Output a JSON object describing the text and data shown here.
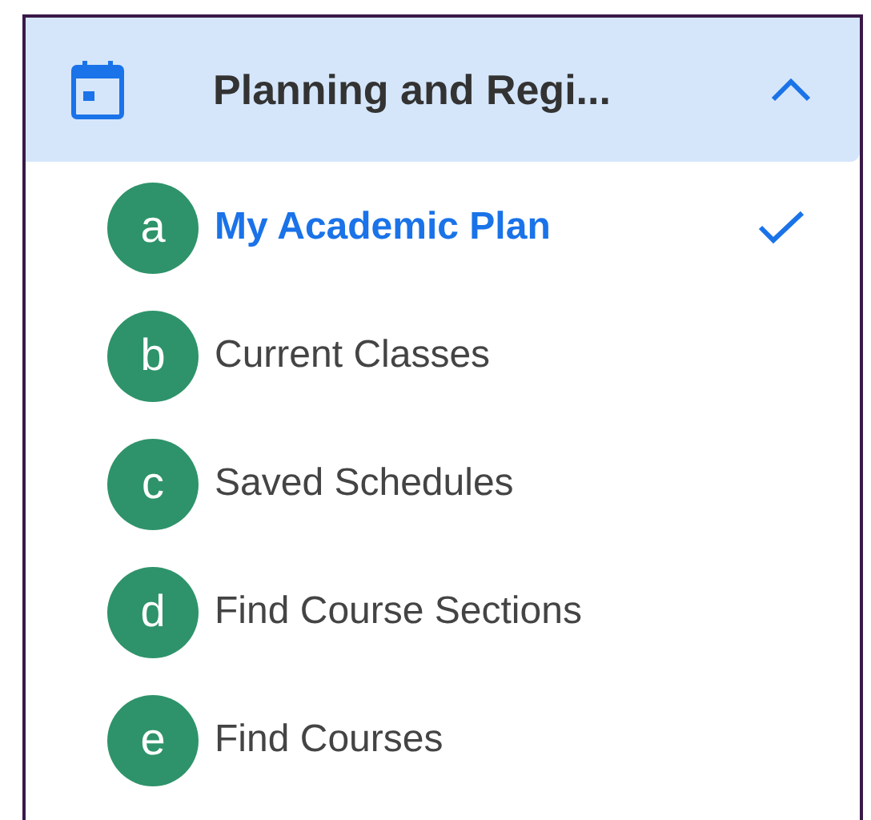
{
  "section": {
    "title": "Planning and Regi...",
    "expanded": true
  },
  "items": [
    {
      "badge": "a",
      "label": "My Academic Plan",
      "selected": true
    },
    {
      "badge": "b",
      "label": "Current Classes",
      "selected": false
    },
    {
      "badge": "c",
      "label": "Saved Schedules",
      "selected": false
    },
    {
      "badge": "d",
      "label": "Find Course Sections",
      "selected": false
    },
    {
      "badge": "e",
      "label": "Find Courses",
      "selected": false
    }
  ]
}
